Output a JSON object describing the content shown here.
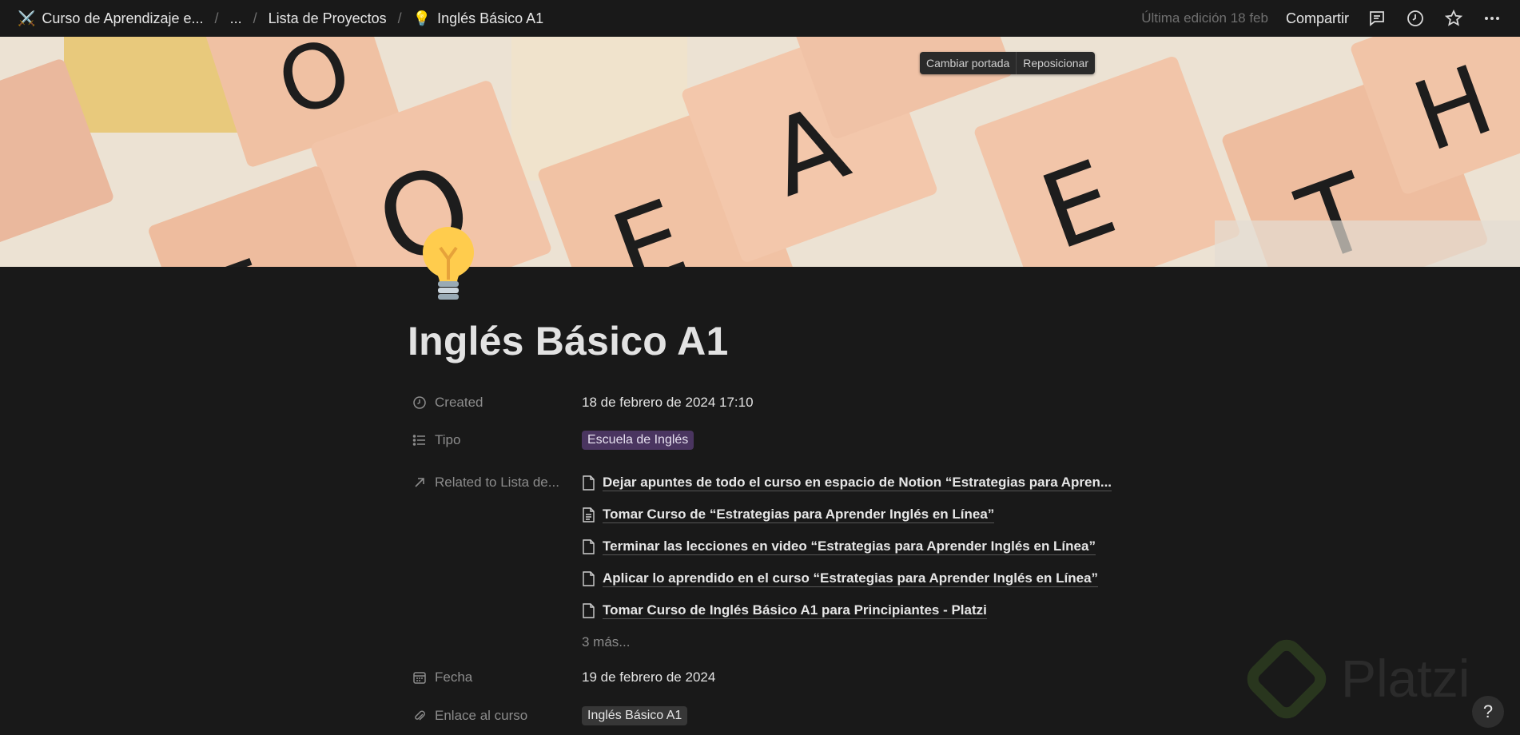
{
  "breadcrumb": {
    "items": [
      {
        "icon": "⚔️",
        "label": "Curso de Aprendizaje e..."
      },
      {
        "icon": "",
        "label": "..."
      },
      {
        "icon": "",
        "label": "Lista de Proyectos"
      },
      {
        "icon": "💡",
        "label": "Inglés Básico A1"
      }
    ],
    "separator": "/"
  },
  "topbar": {
    "last_edited": "Última edición 18 feb",
    "share_label": "Compartir",
    "icons": [
      "comment-icon",
      "history-icon",
      "star-icon",
      "more-icon"
    ]
  },
  "cover": {
    "change_label": "Cambiar portada",
    "reposition_label": "Reposicionar"
  },
  "page": {
    "icon": "💡",
    "title": "Inglés Básico A1"
  },
  "properties": {
    "created": {
      "label": "Created",
      "value": "18 de febrero de 2024 17:10"
    },
    "tipo": {
      "label": "Tipo",
      "value": "Escuela de Inglés"
    },
    "related": {
      "label": "Related to Lista de...",
      "items": [
        "Dejar apuntes de todo el curso en espacio de Notion “Estrategias para Apren...",
        "Tomar Curso de “Estrategias para Aprender Inglés en Línea”",
        "Terminar las lecciones en video “Estrategias para Aprender Inglés en Línea”",
        "Aplicar lo aprendido en el curso “Estrategias para Aprender Inglés en Línea”",
        "Tomar Curso de Inglés Básico A1 para Principiantes - Platzi"
      ],
      "more": "3 más..."
    },
    "fecha": {
      "label": "Fecha",
      "value": "19 de febrero de 2024"
    },
    "enlace": {
      "label": "Enlace al curso",
      "value": "Inglés Básico A1"
    }
  },
  "watermark": {
    "text": "Platzi"
  },
  "help": {
    "label": "?"
  },
  "colors": {
    "background": "#191919",
    "tag_purple": "#4a3560",
    "tag_gray": "#373737",
    "muted_text": "#8c8c8c"
  }
}
